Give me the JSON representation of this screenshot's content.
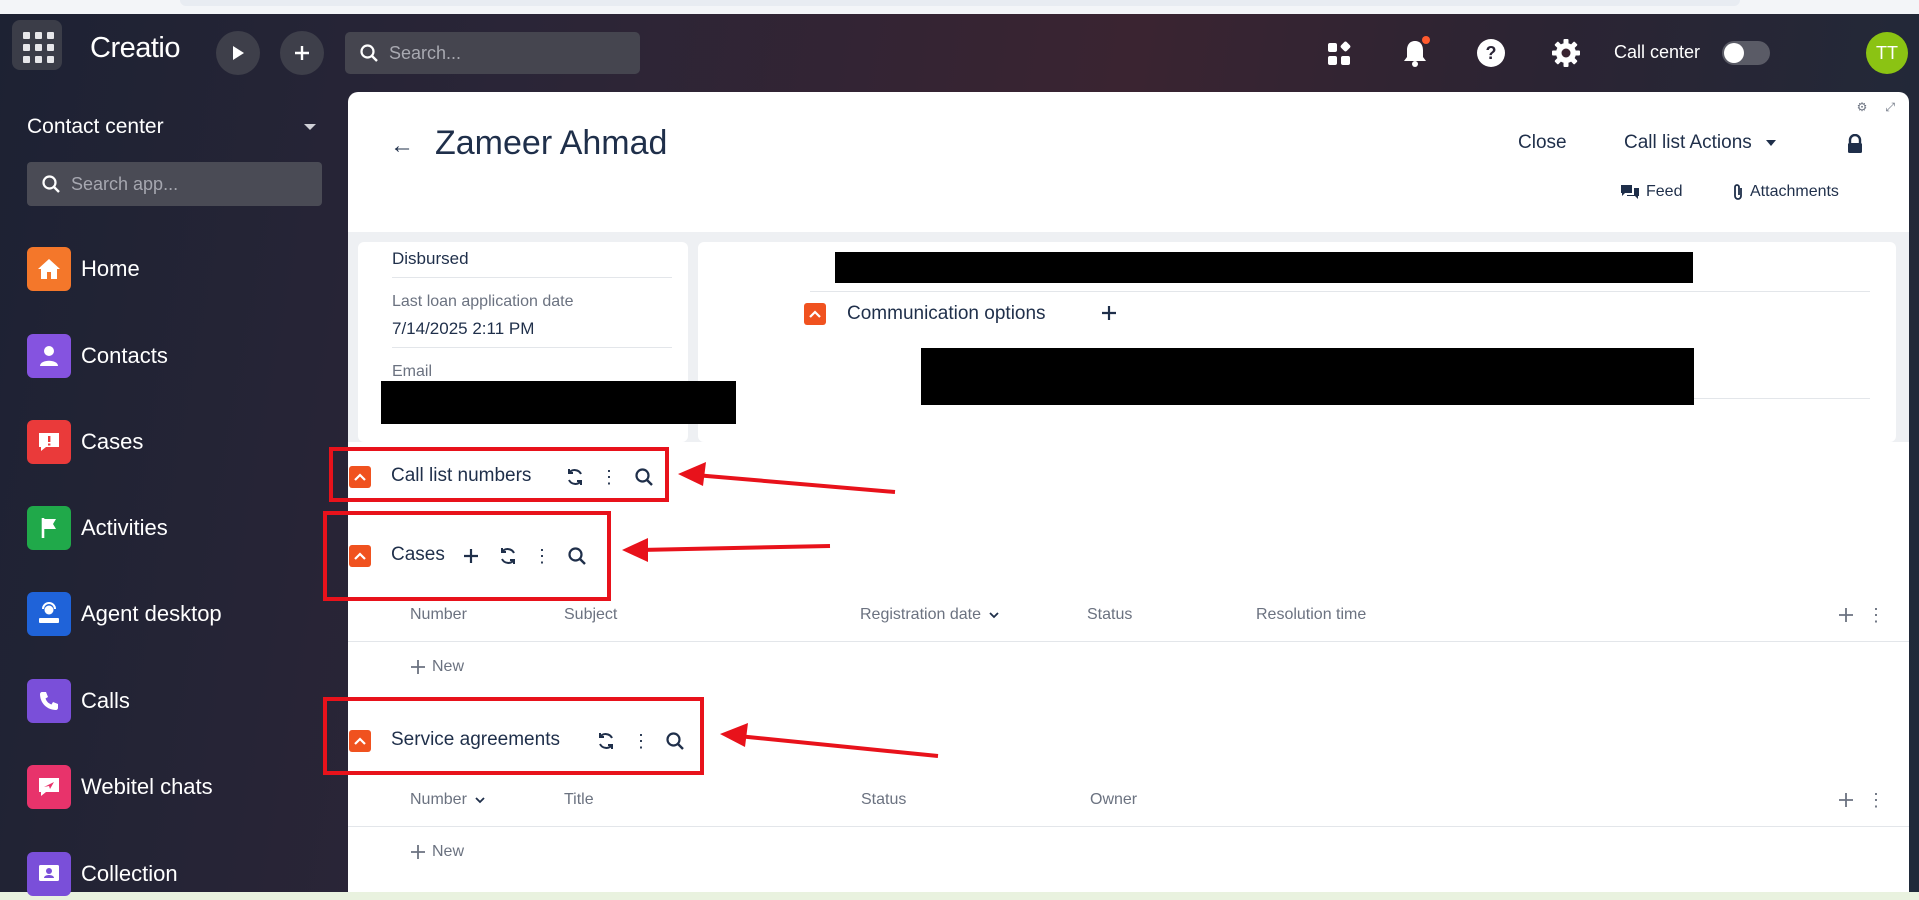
{
  "header": {
    "logo": "Creatio",
    "search_placeholder": "Search...",
    "call_center_label": "Call center",
    "avatar_initials": "TT"
  },
  "sidebar": {
    "app_title": "Contact center",
    "search_placeholder": "Search app...",
    "items": [
      {
        "label": "Home",
        "icon": "home-icon",
        "color": "#f4772a"
      },
      {
        "label": "Contacts",
        "icon": "person-icon",
        "color": "#8553e0"
      },
      {
        "label": "Cases",
        "icon": "alert-chat-icon",
        "color": "#ea3a3a"
      },
      {
        "label": "Activities",
        "icon": "flag-icon",
        "color": "#20a94a"
      },
      {
        "label": "Agent desktop",
        "icon": "agent-icon",
        "color": "#1f63d9"
      },
      {
        "label": "Calls",
        "icon": "phone-icon",
        "color": "#7a4fd9"
      },
      {
        "label": "Webitel chats",
        "icon": "chat-send-icon",
        "color": "#e8336b"
      },
      {
        "label": "Collection",
        "icon": "contact-card-icon",
        "color": "#7a4fd9"
      }
    ]
  },
  "record": {
    "title": "Zameer Ahmad",
    "close_label": "Close",
    "actions_label": "Call list Actions",
    "feed_label": "Feed",
    "attachments_label": "Attachments",
    "status_value": "Disbursed",
    "last_loan_label": "Last loan application date",
    "last_loan_value": "7/14/2025 2:11 PM",
    "email_label": "Email",
    "communication_options": "Communication options"
  },
  "sections": {
    "call_list_numbers": "Call list numbers",
    "cases": {
      "title": "Cases",
      "columns": [
        "Number",
        "Subject",
        "Registration date",
        "Status",
        "Resolution time"
      ],
      "new_label": "New"
    },
    "service_agreements": {
      "title": "Service agreements",
      "columns": [
        "Number",
        "Title",
        "Status",
        "Owner"
      ],
      "new_label": "New"
    }
  },
  "colors": {
    "accent": "#f0521f",
    "annotation": "#e8121b",
    "avatar": "#8bc313"
  }
}
